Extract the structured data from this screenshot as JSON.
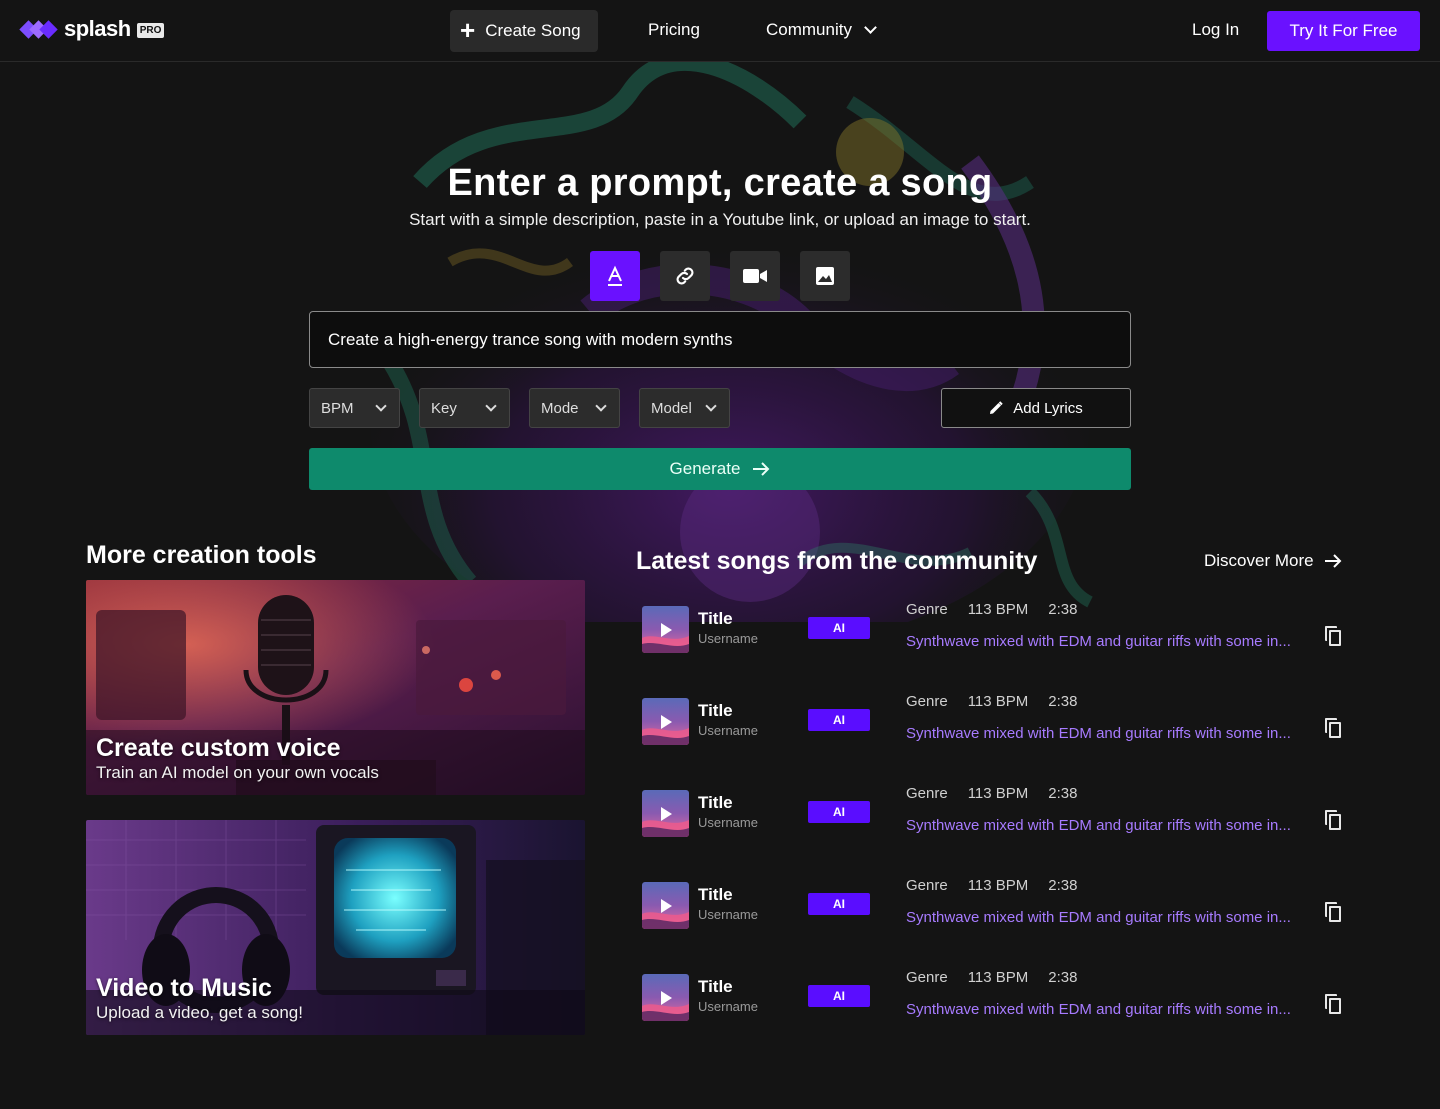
{
  "brand": {
    "name": "splash",
    "badge": "PRO",
    "accent": "#6a11ff"
  },
  "nav": {
    "create_song": "Create Song",
    "pricing": "Pricing",
    "community": "Community",
    "login": "Log In",
    "try_free": "Try It For Free"
  },
  "hero": {
    "title": "Enter a prompt, create a song",
    "subtitle": "Start with a simple description, paste in a Youtube link, or upload an image to start.",
    "modes": [
      {
        "icon": "text-icon",
        "active": true
      },
      {
        "icon": "link-icon",
        "active": false
      },
      {
        "icon": "video-camera-icon",
        "active": false
      },
      {
        "icon": "image-icon",
        "active": false
      }
    ],
    "prompt_value": "Create a high-energy trance song with modern synths",
    "selects": {
      "bpm": "BPM",
      "key": "Key",
      "mode": "Mode",
      "model": "Model"
    },
    "add_lyrics": "Add Lyrics",
    "generate": "Generate",
    "generate_color": "#0e8a6c"
  },
  "tools": {
    "title": "More creation tools",
    "items": [
      {
        "name": "Create custom voice",
        "description": "Train an AI model on your own vocals"
      },
      {
        "name": "Video to Music",
        "description": "Upload a video, get a song!"
      }
    ]
  },
  "community": {
    "title": "Latest songs from the community",
    "discover": "Discover More",
    "songs": [
      {
        "title": "Title",
        "user": "Username",
        "badge": "AI",
        "genre": "Genre",
        "bpm": "113 BPM",
        "duration": "2:38",
        "description": "Synthwave mixed with EDM and guitar riffs with some in..."
      },
      {
        "title": "Title",
        "user": "Username",
        "badge": "AI",
        "genre": "Genre",
        "bpm": "113 BPM",
        "duration": "2:38",
        "description": "Synthwave mixed with EDM and guitar riffs with some in..."
      },
      {
        "title": "Title",
        "user": "Username",
        "badge": "AI",
        "genre": "Genre",
        "bpm": "113 BPM",
        "duration": "2:38",
        "description": "Synthwave mixed with EDM and guitar riffs with some in..."
      },
      {
        "title": "Title",
        "user": "Username",
        "badge": "AI",
        "genre": "Genre",
        "bpm": "113 BPM",
        "duration": "2:38",
        "description": "Synthwave mixed with EDM and guitar riffs with some in..."
      },
      {
        "title": "Title",
        "user": "Username",
        "badge": "AI",
        "genre": "Genre",
        "bpm": "113 BPM",
        "duration": "2:38",
        "description": "Synthwave mixed with EDM and guitar riffs with some in..."
      }
    ]
  }
}
